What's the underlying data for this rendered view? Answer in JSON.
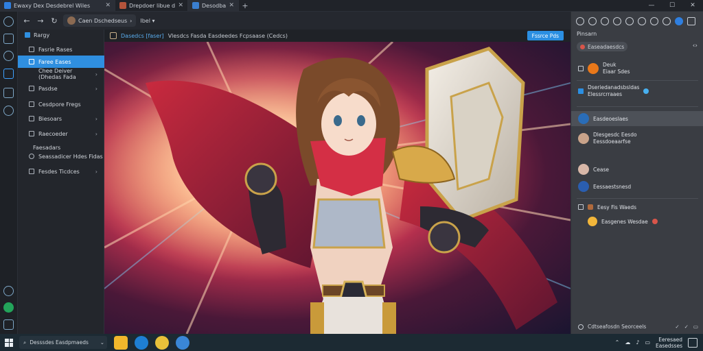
{
  "browser": {
    "tabs": [
      {
        "title": "Ewaxy Dex Desdebrel Wiles",
        "favicon_color": "#2f7fe0"
      },
      {
        "title": "Drepdoer libue dhelipelak",
        "favicon_color": "#b5543b"
      },
      {
        "title": "Desodbaee",
        "favicon_color": "#3a7fd0"
      }
    ],
    "new_tab": "+",
    "window_controls": {
      "minimize": "—",
      "maximize": "☐",
      "close": "✕"
    }
  },
  "address_bar": {
    "profile_label": "Caen Dschedseus",
    "profile_chevron": "›",
    "breadcrumb": "Ibel",
    "breadcrumb_chevron": "▾"
  },
  "left_panel": {
    "header": "Rargy",
    "items": [
      {
        "label": "Fasrie Rases",
        "chevron": ""
      },
      {
        "label": "Faree Eases",
        "chevron": "",
        "active": true
      },
      {
        "label": "Chee Deiver (Dhedas Fada",
        "chevron": "›"
      },
      {
        "label": "Pasdse",
        "chevron": "›"
      },
      {
        "label": "Cesdpore Fregs",
        "chevron": ""
      },
      {
        "label": "Biesoars",
        "chevron": "›"
      },
      {
        "label": "Raecoeder",
        "chevron": "›"
      },
      {
        "label": "Faesadars",
        "chevron": ""
      },
      {
        "label": "Seassadicer Hdes Fidas",
        "chevron": ""
      },
      {
        "label": "Fesdes Ticdces",
        "chevron": "›"
      }
    ]
  },
  "image_strip": {
    "title_blue": "Dasedcs [faser]",
    "title_rest": "Vlesdcs Fasda Easdeedes Fcpsaase (Cedcs)",
    "action_button": "Fssrce Pds"
  },
  "right_panel": {
    "heading": "Pinsarn",
    "search_value": "Easeadaesdcs",
    "arrows": "‹›",
    "rows": [
      {
        "name": "Deuk",
        "sub": "Eiaar Sdes",
        "avatar_color": "#e9781a"
      },
      {
        "name": "Dseriedanadsbsldas",
        "sub": "Elessrcrraaes",
        "avatar_color": "#2b8fe2"
      },
      {
        "name": "Easdeoeslaes",
        "sub": "",
        "avatar_color": "#2a6db8",
        "selected": true
      },
      {
        "name": "Dlesgesdc Eesdo",
        "sub": "Eessdoeaarfse",
        "avatar_color": "#c9a38a"
      },
      {
        "name": "Cease",
        "sub": "",
        "avatar_color": "#d8b7a8"
      },
      {
        "name": "Eessaestsnesd",
        "sub": "",
        "avatar_color": "#2a5eb0"
      },
      {
        "name": "Eesy Fis Waeds",
        "sub": "",
        "avatar_color": "#b06a3c"
      },
      {
        "name": "Easgenes Wesdae",
        "sub": "",
        "avatar_color": "#f2b63a"
      }
    ],
    "footer": "Cdtseafosdn Seorceels"
  },
  "taskbar": {
    "search_label": "Desssdes Easdpmaeds",
    "apps": [
      {
        "name": "file-explorer",
        "color": "#f0b72c"
      },
      {
        "name": "edge",
        "color": "#1e7fd3"
      },
      {
        "name": "chrome",
        "color": "#e8c13a"
      },
      {
        "name": "store",
        "color": "#3a86d6"
      }
    ],
    "clock_time": "Eeresaed",
    "clock_date": "Easedsses"
  }
}
